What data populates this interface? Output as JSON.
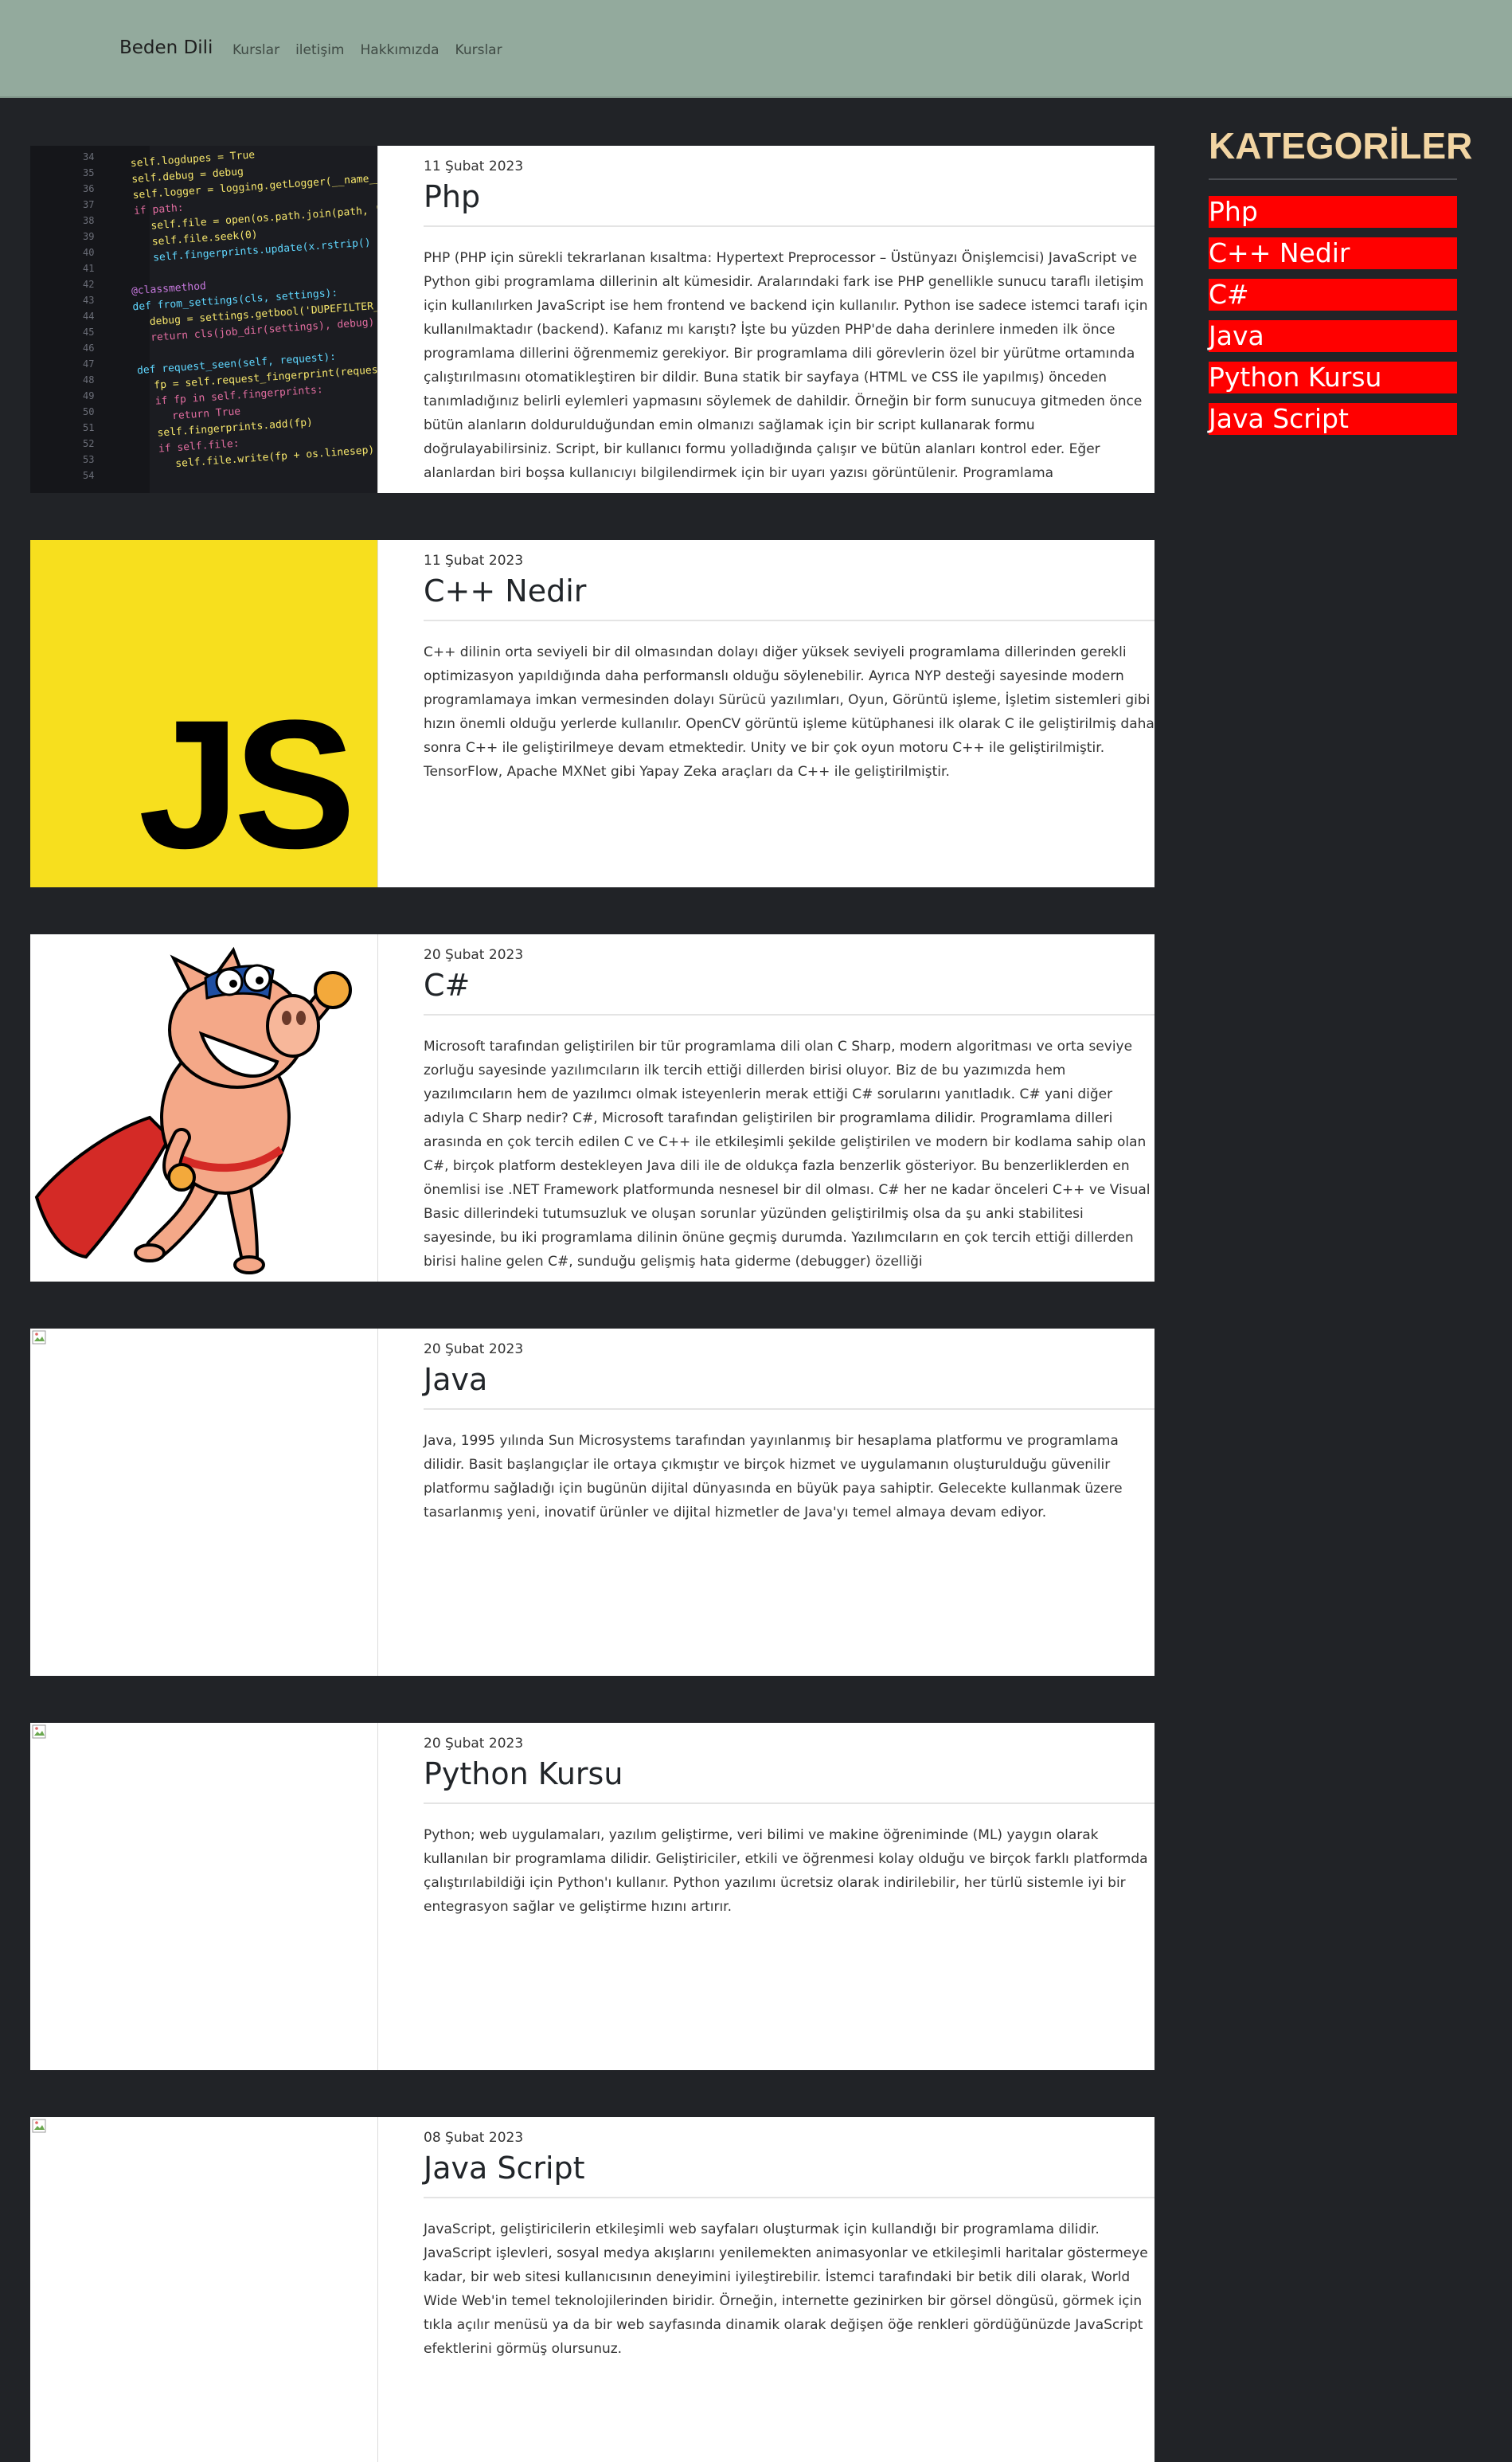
{
  "nav": {
    "brand": "Beden Dili",
    "links": [
      "Kurslar",
      "iletişim",
      "Hakkımızda",
      "Kurslar"
    ]
  },
  "posts": [
    {
      "date": "11 Şubat 2023",
      "title": "Php",
      "text": "PHP (PHP için sürekli tekrarlanan kısaltma: Hypertext Preprocessor – Üstünyazı Önişlemcisi) JavaScript ve Python gibi programlama dillerinin alt kümesidir. Aralarındaki fark ise PHP genellikle sunucu taraflı iletişim için kullanılırken JavaScript ise hem frontend ve backend için kullanılır. Python ise sadece istemci tarafı için kullanılmaktadır (backend). Kafanız mı karıştı? İşte bu yüzden PHP'de daha derinlere inmeden ilk önce programlama dillerini öğrenmemiz gerekiyor. Bir programlama dili görevlerin özel bir yürütme ortamında çalıştırılmasını otomatikleştiren bir dildir. Buna statik bir sayfaya (HTML ve CSS ile yapılmış) önceden tanımladığınız belirli eylemleri yapmasını söylemek de dahildir. Örneğin bir form sunucuya gitmeden önce bütün alanların doldurulduğundan emin olmanızı sağlamak için bir script kullanarak formu doğrulayabilirsiniz. Script, bir kullanıcı formu yolladığında çalışır ve bütün alanları kontrol eder. Eğer alanlardan biri boşsa kullanıcıyı bilgilendirmek için bir uyarı yazısı görüntülenir. Programlama",
      "image": "code-screenshot"
    },
    {
      "date": "11 Şubat 2023",
      "title": "C++ Nedir",
      "text": "C++ dilinin orta seviyeli bir dil olmasından dolayı diğer yüksek seviyeli programlama dillerinden gerekli optimizasyon yapıldığında daha performanslı olduğu söylenebilir. Ayrıca NYP desteği sayesinde modern programlamaya imkan vermesinden dolayı Sürücü yazılımları, Oyun, Görüntü işleme, İşletim sistemleri gibi hızın önemli olduğu yerlerde kullanılır. OpenCV görüntü işleme kütüphanesi ilk olarak C ile geliştirilmiş daha sonra C++ ile geliştirilmeye devam etmektedir. Unity ve bir çok oyun motoru C++ ile geliştirilmiştir. TensorFlow, Apache MXNet gibi Yapay Zeka araçları da C++ ile geliştirilmiştir.",
      "image": "js-logo",
      "logo_text": "JS"
    },
    {
      "date": "20 Şubat 2023",
      "title": "C#",
      "text": "Microsoft tarafından geliştirilen bir tür programlama dili olan C Sharp, modern algoritması ve orta seviye zorluğu sayesinde yazılımcıların ilk tercih ettiği dillerden birisi oluyor. Biz de bu yazımızda hem yazılımcıların hem de yazılımcı olmak isteyenlerin merak ettiği C# sorularını yanıtladık. C# yani diğer adıyla C Sharp nedir? C#, Microsoft tarafından geliştirilen bir programlama dilidir. Programlama dilleri arasında en çok tercih edilen C ve C++ ile etkileşimli şekilde geliştirilen ve modern bir kodlama sahip olan C#, birçok platform destekleyen Java dili ile de oldukça fazla benzerlik gösteriyor. Bu benzerliklerden en önemlisi ise .NET Framework platformunda nesnesel bir dil olması. C# her ne kadar önceleri C++ ve Visual Basic dillerindeki tutumsuzluk ve oluşan sorunlar yüzünden geliştirilmiş olsa da şu anki stabilitesi sayesinde, bu iki programlama dilinin önüne geçmiş durumda. Yazılımcıların en çok tercih ettiği dillerden birisi haline gelen C#, sunduğu gelişmiş hata giderme (debugger) özelliği",
      "image": "superhero-pig"
    },
    {
      "date": "20 Şubat 2023",
      "title": "Java",
      "text": "Java, 1995 yılında Sun Microsystems tarafından yayınlanmış bir hesaplama platformu ve programlama dilidir. Basit başlangıçlar ile ortaya çıkmıştır ve birçok hizmet ve uygulamanın oluşturulduğu güvenilir platformu sağladığı için bugünün dijital dünyasında en büyük paya sahiptir. Gelecekte kullanmak üzere tasarlanmış yeni, inovatif ürünler ve dijital hizmetler de Java'yı temel almaya devam ediyor.",
      "image": "broken-image"
    },
    {
      "date": "20 Şubat 2023",
      "title": "Python Kursu",
      "text": "Python; web uygulamaları, yazılım geliştirme, veri bilimi ve makine öğreniminde (ML) yaygın olarak kullanılan bir programlama dilidir. Geliştiriciler, etkili ve öğrenmesi kolay olduğu ve birçok farklı platformda çalıştırılabildiği için Python'ı kullanır. Python yazılımı ücretsiz olarak indirilebilir, her türlü sistemle iyi bir entegrasyon sağlar ve geliştirme hızını artırır.",
      "image": "broken-image"
    },
    {
      "date": "08 Şubat 2023",
      "title": "Java Script",
      "text": "JavaScript, geliştiricilerin etkileşimli web sayfaları oluşturmak için kullandığı bir programlama dilidir. JavaScript işlevleri, sosyal medya akışlarını yenilemekten animasyonlar ve etkileşimli haritalar göstermeye kadar, bir web sitesi kullanıcısının deneyimini iyileştirebilir. İstemci tarafındaki bir betik dili olarak, World Wide Web'in temel teknolojilerinden biridir. Örneğin, internette gezinirken bir görsel döngüsü, görmek için tıkla açılır menüsü ya da bir web sayfasında dinamik olarak değişen öğe renkleri gördüğünüzde JavaScript efektlerini görmüş olursunuz.",
      "image": "broken-image"
    }
  ],
  "sidebar": {
    "title": "KATEGORİLER",
    "categories": [
      "Php",
      "C++ Nedir",
      "C#",
      "Java",
      "Python Kursu",
      "Java Script"
    ]
  },
  "colors": {
    "nav_bg": "#93aa9d",
    "page_bg": "#212327",
    "sidebar_title": "#f2d5a3",
    "category_bg": "#ff0000"
  }
}
